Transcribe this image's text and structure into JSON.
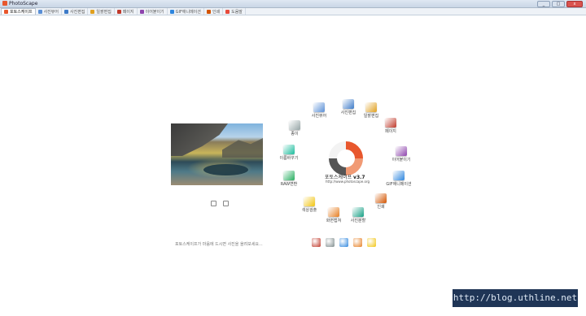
{
  "window": {
    "title": "PhotoScape",
    "minimize": "_",
    "maximize": "□",
    "close": "x"
  },
  "tabs": [
    {
      "label": "포토스케이프",
      "color": "#e8572d"
    },
    {
      "label": "사진뷰어",
      "color": "#5a8fd6"
    },
    {
      "label": "사진편집",
      "color": "#3c7ac8"
    },
    {
      "label": "일괄편집",
      "color": "#e0a020"
    },
    {
      "label": "페이지",
      "color": "#c0392b"
    },
    {
      "label": "이어붙이기",
      "color": "#8e44ad"
    },
    {
      "label": "GIF애니메이션",
      "color": "#2e86de"
    },
    {
      "label": "인쇄",
      "color": "#d35400"
    },
    {
      "label": "도움말",
      "color": "#e74c3c"
    }
  ],
  "hint": "포토스케이프가 마음에 드시면 사진을 올려보세요...",
  "center": {
    "name": "포토스케이프",
    "version": "v3.7",
    "url": "http://www.photoscape.org"
  },
  "ring": [
    {
      "label": "사진편집",
      "color": "#3c7ac8"
    },
    {
      "label": "일괄편집",
      "color": "#e0a020"
    },
    {
      "label": "페이지",
      "color": "#c0392b"
    },
    {
      "label": "이어붙이기",
      "color": "#8e44ad"
    },
    {
      "label": "GIF애니메이션",
      "color": "#2e86de"
    },
    {
      "label": "인쇄",
      "color": "#d35400"
    },
    {
      "label": "사진분할",
      "color": "#16a085"
    },
    {
      "label": "화면캡쳐",
      "color": "#e67e22"
    },
    {
      "label": "색상검출",
      "color": "#f1c40f"
    },
    {
      "label": "RAW변환",
      "color": "#27ae60"
    },
    {
      "label": "이름바꾸기",
      "color": "#1abc9c"
    },
    {
      "label": "종이",
      "color": "#95a5a6"
    },
    {
      "label": "사진뷰어",
      "color": "#5a8fd6"
    }
  ],
  "bottom_icons": [
    {
      "name": "font-icon",
      "color": "#c0392b"
    },
    {
      "name": "tool-icon",
      "color": "#7f8c8d"
    },
    {
      "name": "refresh-icon",
      "color": "#2e86de"
    },
    {
      "name": "gallery-icon",
      "color": "#e67e22"
    },
    {
      "name": "sun-icon",
      "color": "#f1c40f"
    }
  ],
  "watermark": "http://blog.uthline.net"
}
